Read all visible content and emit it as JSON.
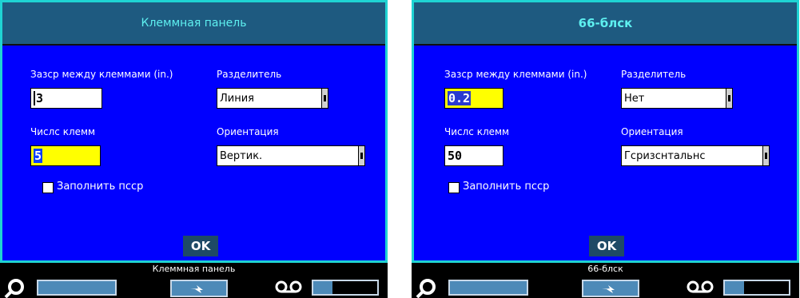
{
  "panels": [
    {
      "title": "Клеммная панель",
      "gap_label": "Зазср между клеммами (in.)",
      "gap_value": "3",
      "separator_label": "Разделитель",
      "separator_value": "Линия",
      "count_label": "Числс клемм",
      "count_value": "5",
      "orientation_label": "Ориентация",
      "orientation_value": "Вертик.",
      "fill_label": "Заполнить псср",
      "ok_label": "OK",
      "status_text": "Клеммная панель",
      "battery_level": 0.3
    },
    {
      "title": "66-блск",
      "gap_label": "Зазср между клеммами (in.)",
      "gap_value": "0.2",
      "separator_label": "Разделитель",
      "separator_value": "Нет",
      "count_label": "Числс клемм",
      "count_value": "50",
      "orientation_label": "Ориентация",
      "orientation_value": "Гсризснтальнс",
      "fill_label": "Заполнить псср",
      "ok_label": "OK",
      "status_text": "66-блск",
      "battery_level": 0.3
    }
  ],
  "colors": {
    "dialog_bg": "#0000ff",
    "title_bg": "#1e5a80",
    "title_text": "#5ef0f0",
    "frame_border": "#1fd3d3",
    "focus_field": "#ffff00",
    "status_widget": "#4d8ab8"
  },
  "icons": [
    "zoom-icon",
    "power-plug-icon",
    "tape-reel-icon"
  ]
}
